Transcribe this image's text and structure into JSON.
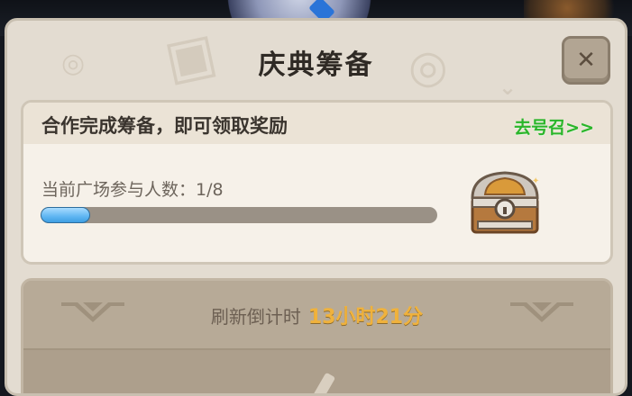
{
  "dialog": {
    "title": "庆典筹备",
    "close_icon": "close-icon"
  },
  "task": {
    "title": "合作完成筹备，即可领取奖励",
    "go_summon": "去号召>>",
    "participants_label": "当前广场参与人数：1/8",
    "progress": {
      "current": 1,
      "total": 8
    },
    "reward_icon": "treasure-chest-icon"
  },
  "refresh": {
    "label": "刷新倒计时",
    "value": "13小时21分"
  },
  "colors": {
    "accent_green": "#2ab52a",
    "progress_blue": "#5fb6f2",
    "countdown_orange": "#f0b23c"
  }
}
